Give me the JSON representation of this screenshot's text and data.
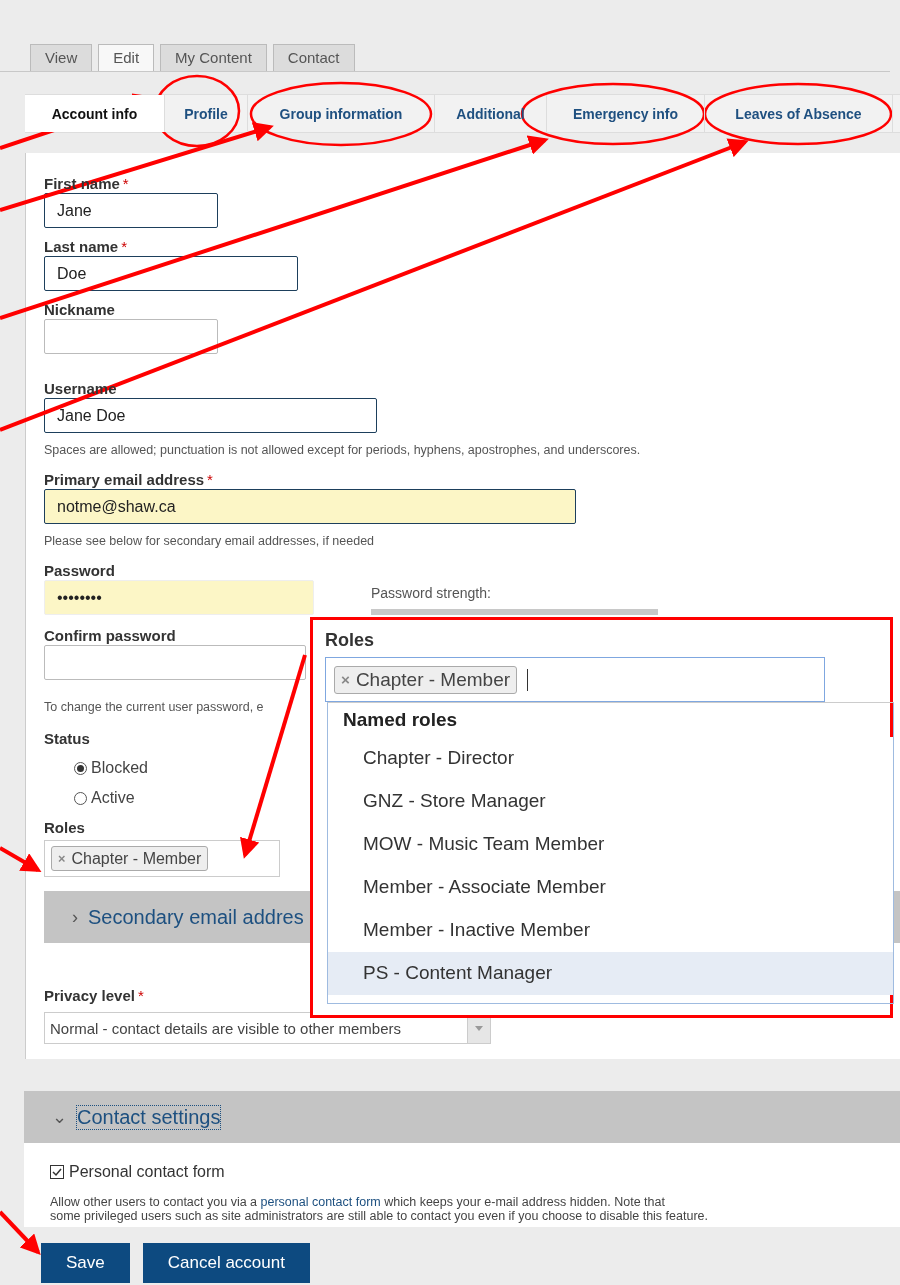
{
  "primary_tabs": [
    {
      "label": "View",
      "selected": false
    },
    {
      "label": "Edit",
      "selected": true
    },
    {
      "label": "My Content",
      "selected": false
    },
    {
      "label": "Contact",
      "selected": false
    }
  ],
  "section_tabs": [
    {
      "label": "Account info",
      "selected": true
    },
    {
      "label": "Profile",
      "selected": false
    },
    {
      "label": "Group information",
      "selected": false
    },
    {
      "label": "Additional",
      "selected": false
    },
    {
      "label": "Emergency info",
      "selected": false
    },
    {
      "label": "Leaves of Absence",
      "selected": false
    }
  ],
  "required_mark": "*",
  "fields": [
    {
      "label": "First name",
      "required": true,
      "value": "Jane"
    },
    {
      "label": "Last name",
      "required": true,
      "value": "Doe"
    },
    {
      "label": "Nickname",
      "required": false
    },
    {
      "label": "Username",
      "required": false,
      "value": "Jane Doe",
      "description": "Spaces are allowed; punctuation is not allowed except for periods, hyphens, apostrophes, and underscores."
    },
    {
      "label": "Primary email address",
      "required": true,
      "value": "notme@shaw.ca",
      "autofilled": true,
      "description": "Please see below for secondary email addresses, if needed"
    }
  ],
  "password": {
    "label": "Password",
    "value": "••••••••",
    "strength_label": "Password strength:"
  },
  "confirm_password": {
    "label": "Confirm password",
    "description": "To change the current user password, e"
  },
  "status": {
    "label": "Status",
    "options": [
      {
        "label": "Blocked",
        "selected": true
      },
      {
        "label": "Active",
        "selected": false
      }
    ]
  },
  "roles": {
    "label": "Roles",
    "tags": [
      "Chapter - Member"
    ],
    "remove_glyph": "×"
  },
  "secondary_email": {
    "label": "Secondary email addres",
    "expanded": false,
    "glyph": "›"
  },
  "privacy": {
    "label": "Privacy level",
    "required": true,
    "value": "Normal - contact details are visible to other members"
  },
  "roles_popup": {
    "label": "Roles",
    "tags": [
      "Chapter - Member"
    ],
    "remove_glyph": "×",
    "group": "Named roles",
    "options": [
      {
        "label": "Chapter - Director",
        "selected": false
      },
      {
        "label": "GNZ - Store Manager",
        "selected": false
      },
      {
        "label": "MOW - Music Team Member",
        "selected": false
      },
      {
        "label": "Member - Associate Member",
        "selected": false
      },
      {
        "label": "Member - Inactive Member",
        "selected": false
      },
      {
        "label": "PS - Content Manager",
        "selected": true
      }
    ]
  },
  "contact_settings": {
    "label": "Contact settings",
    "expanded": true,
    "glyph": "⌄",
    "checkbox": {
      "label": "Personal contact form",
      "checked": true
    },
    "description_start": "Allow other users to contact you via a",
    "description_link": "personal contact form",
    "description_end": "which keeps your e-mail address hidden. Note that",
    "description_2": "some privileged users such as site administrators are still able to contact you even if you choose to disable this feature."
  },
  "buttons": [
    "Save",
    "Cancel account"
  ],
  "annotations": {
    "color": "#ff0000"
  }
}
